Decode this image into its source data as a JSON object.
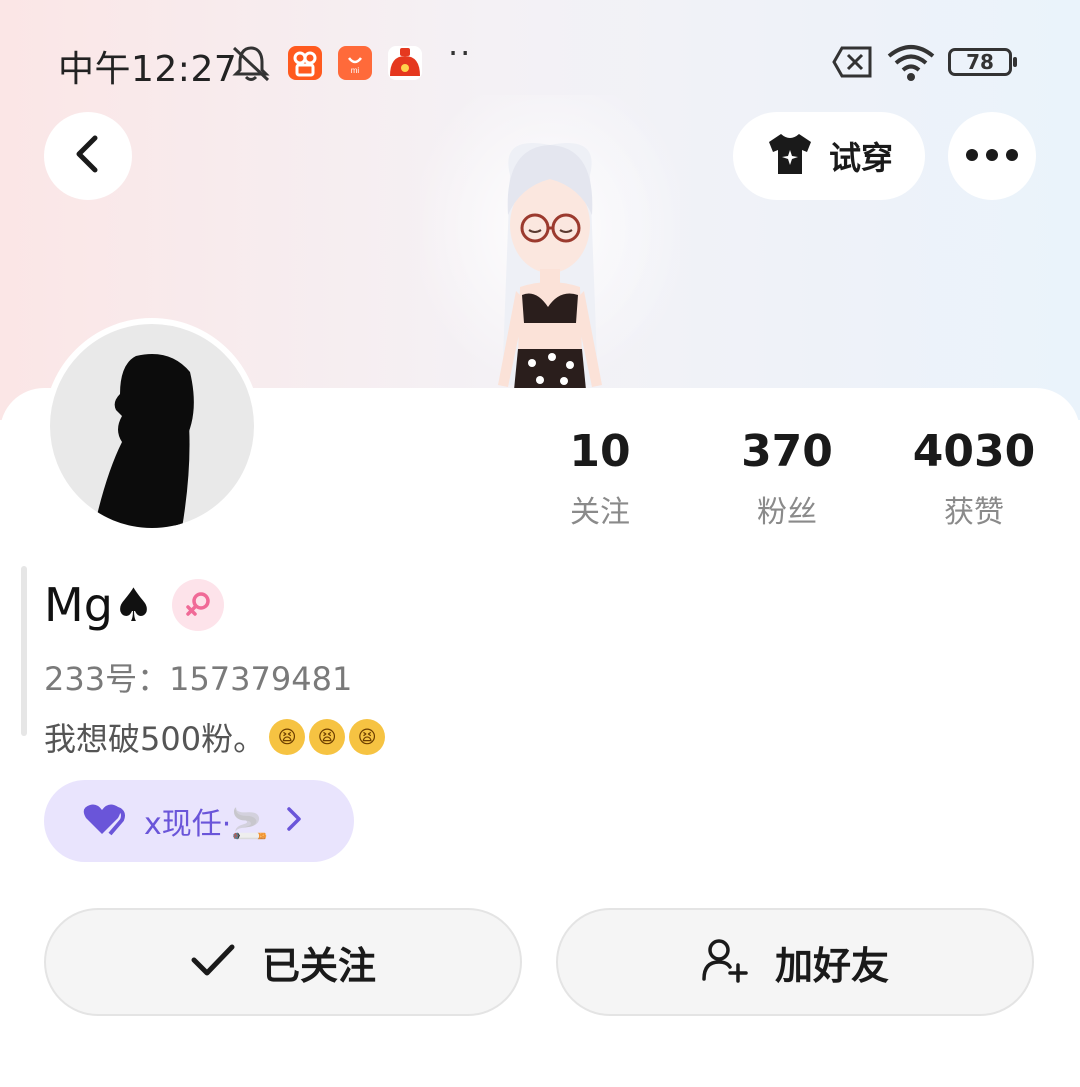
{
  "status_bar": {
    "time": "中午12:27",
    "battery": "78",
    "icons": [
      "mute-bell-icon",
      "kuaishou-app-icon",
      "mi-store-app-icon",
      "shopping-app-icon",
      "more-dots",
      "sim-error-icon",
      "wifi-icon",
      "battery-icon"
    ]
  },
  "header": {
    "try_on_label": "试穿",
    "icons": [
      "back-icon",
      "tshirt-icon",
      "more-icon"
    ]
  },
  "profile": {
    "name": "Mg♠",
    "gender": "female",
    "id_text": "233号：157379481",
    "bio": "我想破500粉。",
    "bio_emojis": [
      "😫",
      "😫",
      "😫"
    ]
  },
  "stats": [
    {
      "value": "10",
      "label": "关注"
    },
    {
      "value": "370",
      "label": "粉丝"
    },
    {
      "value": "4030",
      "label": "获赞"
    }
  ],
  "relation": {
    "label": "x现任·🚬"
  },
  "actions": {
    "follow_label": "已关注",
    "add_friend_label": "加好友"
  },
  "colors": {
    "relation_bg": "#e9e4fd",
    "relation_text": "#6a55d9",
    "gender_bg": "#fde3ea",
    "gender_fg": "#f06a97"
  }
}
